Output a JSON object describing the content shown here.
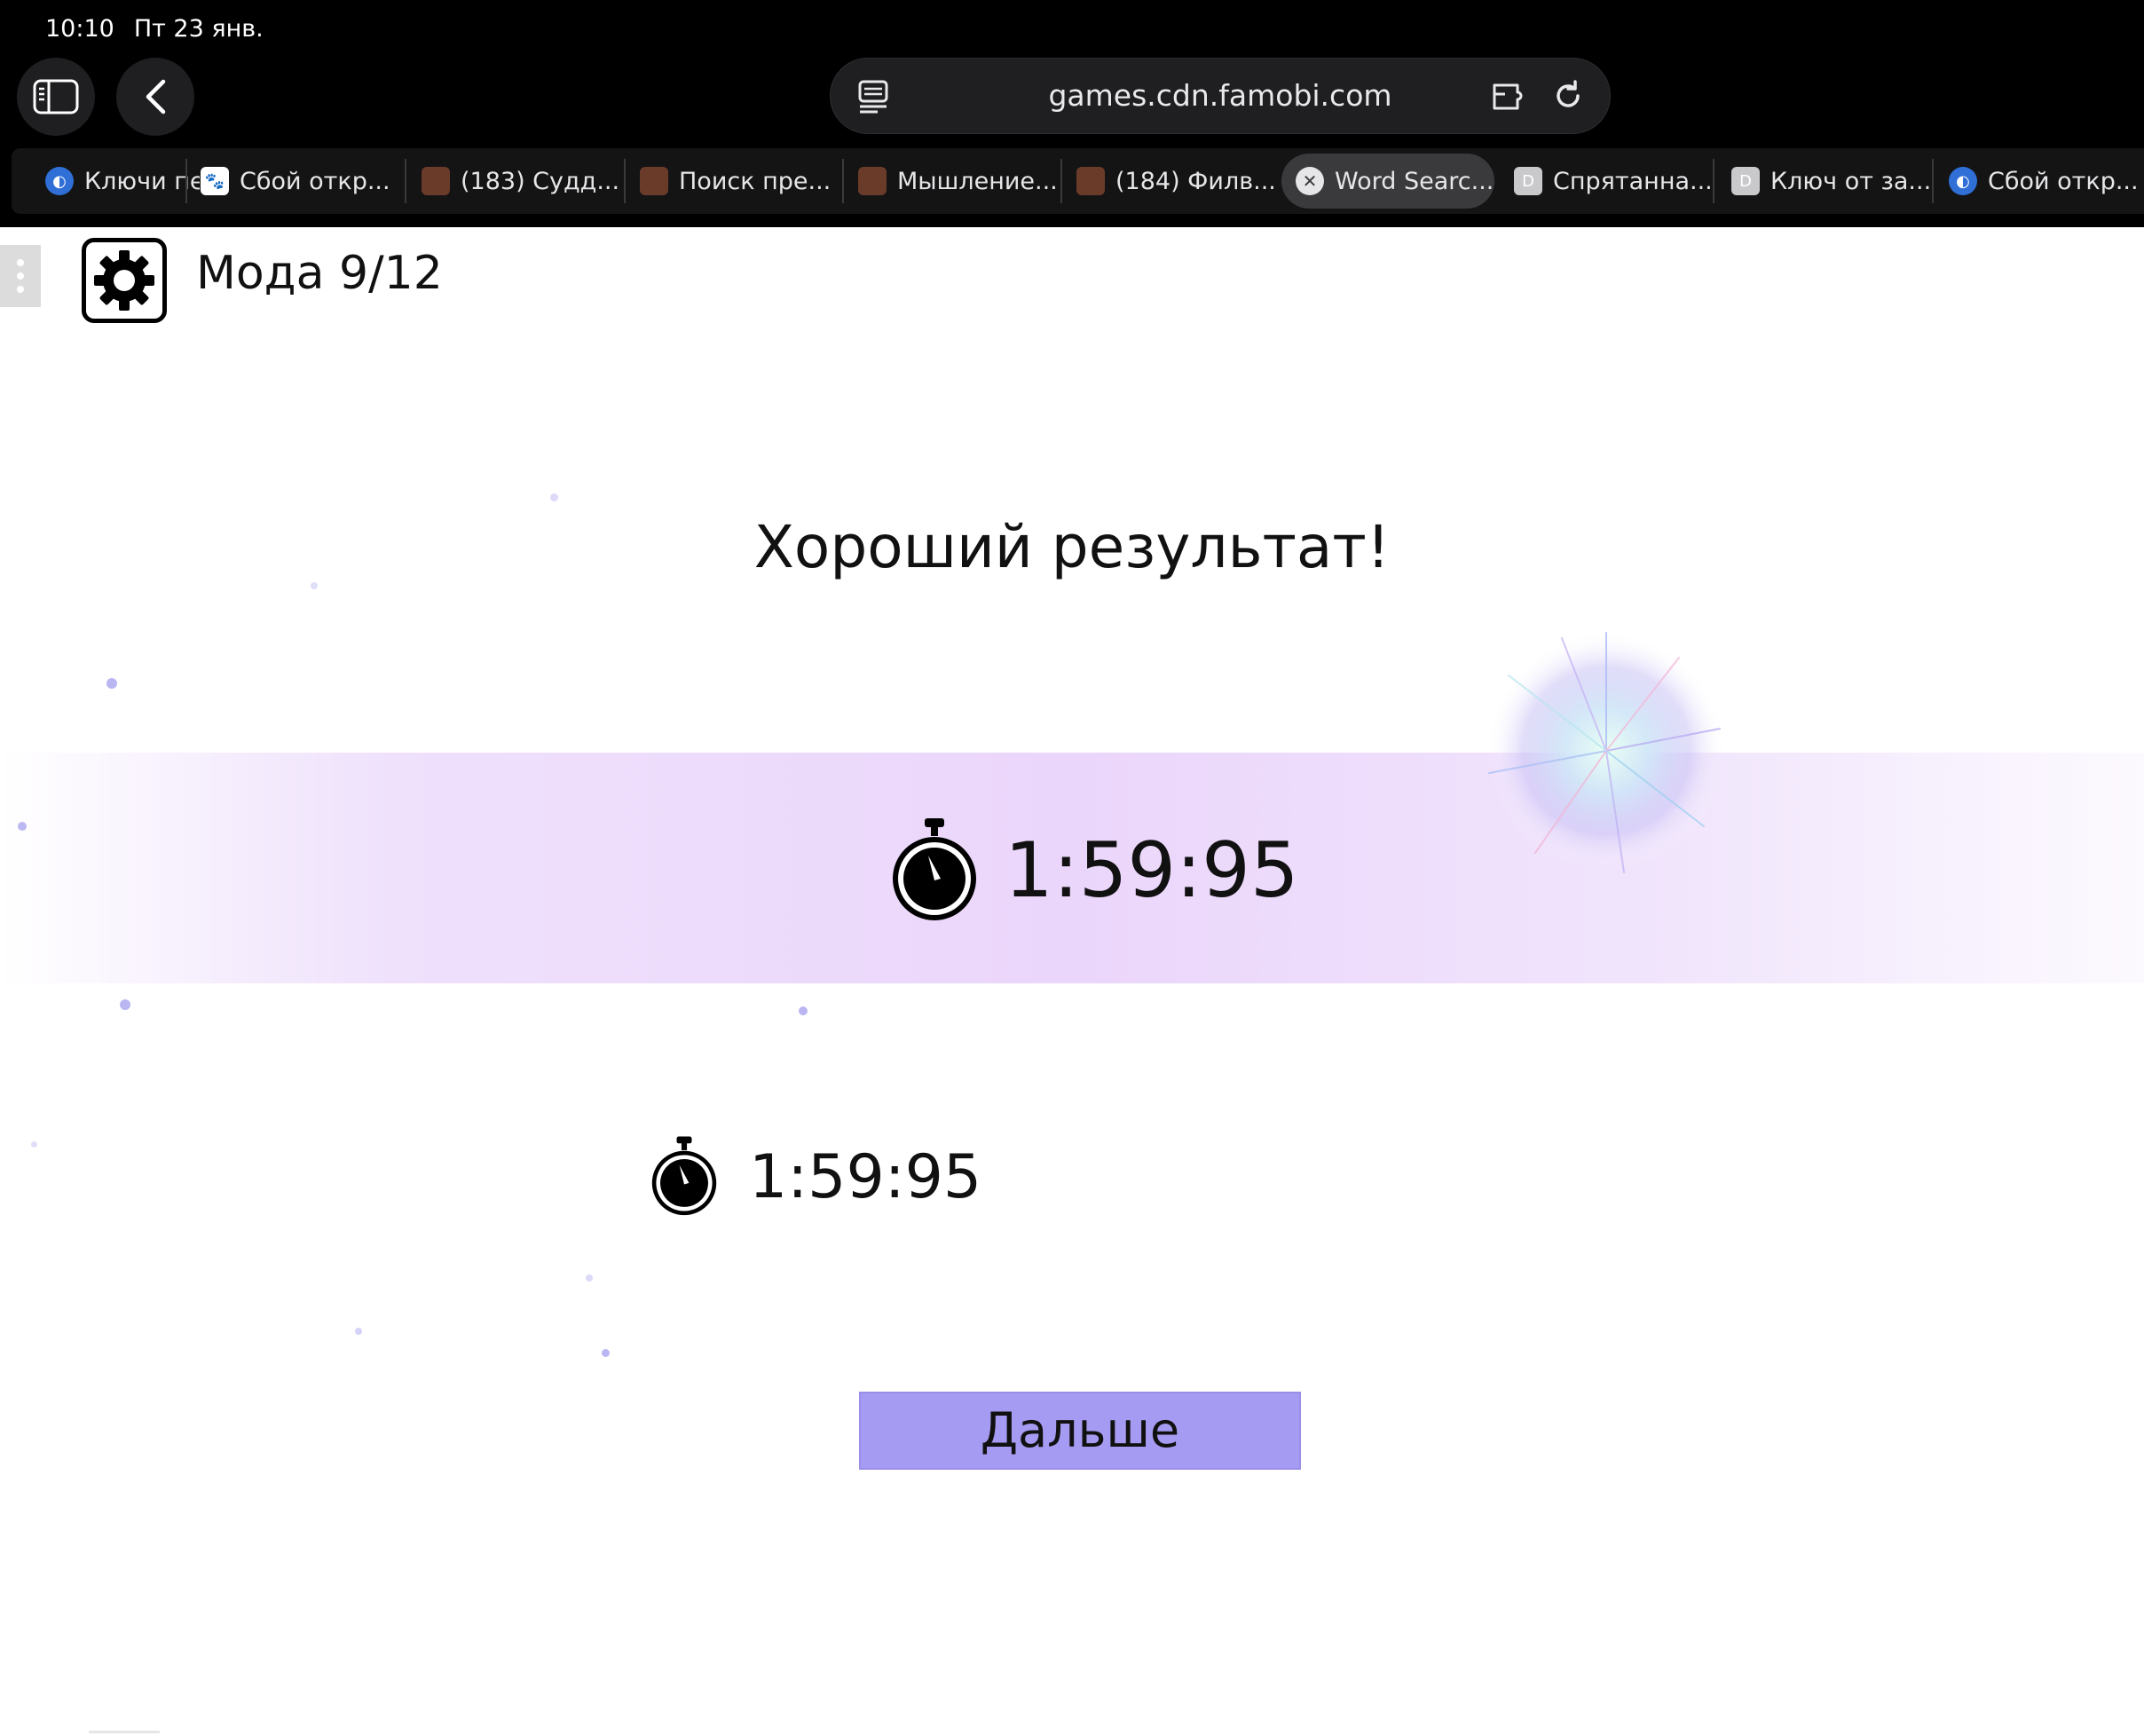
{
  "status_bar": {
    "time": "10:10",
    "date": "Пт 23 янв."
  },
  "browser": {
    "url": "games.cdn.famobi.com",
    "tabs": [
      {
        "label": "Ключи пе",
        "favicon": "edge-globe-icon",
        "active": false
      },
      {
        "label": "Сбой откр...",
        "favicon": "paw-icon",
        "active": false
      },
      {
        "label": "(183) Судд...",
        "favicon": "image-thumbnail-icon",
        "active": false
      },
      {
        "label": "Поиск пре...",
        "favicon": "image-thumbnail-icon",
        "active": false
      },
      {
        "label": "Мышление...",
        "favicon": "image-thumbnail-icon",
        "active": false
      },
      {
        "label": "(184) Филв...",
        "favicon": "image-thumbnail-icon",
        "active": false
      },
      {
        "label": "Word Searc...",
        "favicon": "close-icon",
        "active": true
      },
      {
        "label": "Спрятанна...",
        "favicon": "letter-d-icon",
        "favicon_text": "D",
        "active": false
      },
      {
        "label": "Ключ от за...",
        "favicon": "letter-d-icon",
        "favicon_text": "D",
        "active": false
      },
      {
        "label": "Сбой откр...",
        "favicon": "edge-globe-icon",
        "active": false
      }
    ]
  },
  "game": {
    "level_label": "Мода 9/12",
    "headline": "Хороший результат!",
    "current_time": "1:59:95",
    "best_time": "1:59:95",
    "next_button": "Дальше",
    "colors": {
      "band": "#ebd6fb",
      "button": "#a69bf2"
    }
  }
}
